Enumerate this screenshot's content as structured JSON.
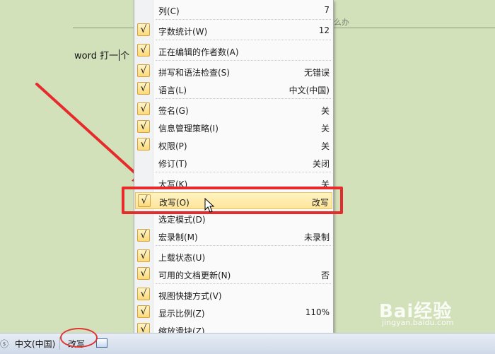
{
  "document": {
    "header_fragment": "么办",
    "text_before_cursor": "word 打一",
    "text_after_cursor": "个"
  },
  "menu": {
    "items": [
      {
        "label": "列(C)",
        "value": "7",
        "checked": false
      },
      {
        "label": "字数统计(W)",
        "value": "12",
        "checked": true
      },
      {
        "label": "正在编辑的作者数(A)",
        "value": "",
        "checked": true
      },
      {
        "label": "拼写和语法检查(S)",
        "value": "无错误",
        "checked": true
      },
      {
        "label": "语言(L)",
        "value": "中文(中国)",
        "checked": true
      },
      {
        "label": "签名(G)",
        "value": "关",
        "checked": true
      },
      {
        "label": "信息管理策略(I)",
        "value": "关",
        "checked": true
      },
      {
        "label": "权限(P)",
        "value": "关",
        "checked": true
      },
      {
        "label": "修订(T)",
        "value": "关闭",
        "checked": false
      },
      {
        "label": "大写(K)",
        "value": "关",
        "checked": false
      },
      {
        "label": "改写(O)",
        "value": "改写",
        "checked": true,
        "highlighted": true
      },
      {
        "label": "选定模式(D)",
        "value": "",
        "checked": false
      },
      {
        "label": "宏录制(M)",
        "value": "未录制",
        "checked": true
      },
      {
        "label": "上载状态(U)",
        "value": "",
        "checked": true
      },
      {
        "label": "可用的文档更新(N)",
        "value": "否",
        "checked": true
      },
      {
        "label": "视图快捷方式(V)",
        "value": "",
        "checked": true
      },
      {
        "label": "显示比例(Z)",
        "value": "110%",
        "checked": true
      },
      {
        "label": "缩放滑块(Z)",
        "value": "",
        "checked": true
      }
    ],
    "check_glyph": "√"
  },
  "statusbar": {
    "language": "中文(中国)",
    "mode": "改写",
    "left_icon": "spellcheck-icon",
    "view_icon": "print-layout-icon"
  },
  "watermark": {
    "brand": "Bai经验",
    "url": "jingyan.baidu.com"
  },
  "colors": {
    "annotation_red": "#e52b2b",
    "highlight": "#fde49a",
    "check_box": "#fbd97a",
    "document_bg": "#d3e1bb"
  }
}
